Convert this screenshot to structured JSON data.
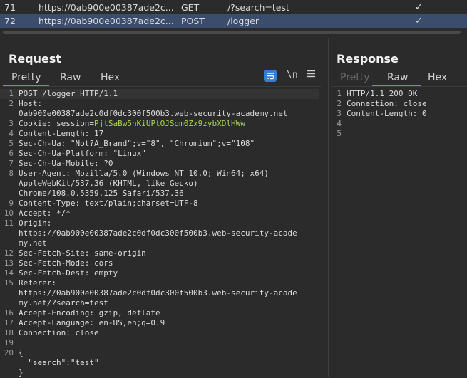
{
  "history": {
    "rows": [
      {
        "num": "71",
        "url": "https://0ab900e00387ade2c...",
        "method": "GET",
        "path": "/?search=test",
        "check": "✓"
      },
      {
        "num": "72",
        "url": "https://0ab900e00387ade2c...",
        "method": "POST",
        "path": "/logger",
        "check": "✓"
      }
    ]
  },
  "request": {
    "title": "Request",
    "tabs": [
      "Pretty",
      "Raw",
      "Hex"
    ],
    "icons": {
      "newline": "\\n",
      "menu": "☰"
    },
    "lines": [
      {
        "n": "1",
        "t": "POST /logger HTTP/1.1"
      },
      {
        "n": "2",
        "t": "Host:"
      },
      {
        "n": "",
        "t": "0ab900e00387ade2c0df0dc300f500b3.web-security-academy.net"
      },
      {
        "n": "3",
        "t": "Cookie: session="
      },
      {
        "n": "4",
        "t": "Content-Length: 17"
      },
      {
        "n": "5",
        "t": "Sec-Ch-Ua: \"Not?A_Brand\";v=\"8\", \"Chromium\";v=\"108\""
      },
      {
        "n": "6",
        "t": "Sec-Ch-Ua-Platform: \"Linux\""
      },
      {
        "n": "7",
        "t": "Sec-Ch-Ua-Mobile: ?0"
      },
      {
        "n": "8",
        "t": "User-Agent: Mozilla/5.0 (Windows NT 10.0; Win64; x64)"
      },
      {
        "n": "",
        "t": "AppleWebKit/537.36 (KHTML, like Gecko)"
      },
      {
        "n": "",
        "t": "Chrome/108.0.5359.125 Safari/537.36"
      },
      {
        "n": "9",
        "t": "Content-Type: text/plain;charset=UTF-8"
      },
      {
        "n": "10",
        "t": "Accept: */*"
      },
      {
        "n": "11",
        "t": "Origin:"
      },
      {
        "n": "",
        "t": "https://0ab900e00387ade2c0df0dc300f500b3.web-security-acade"
      },
      {
        "n": "",
        "t": "my.net"
      },
      {
        "n": "12",
        "t": "Sec-Fetch-Site: same-origin"
      },
      {
        "n": "13",
        "t": "Sec-Fetch-Mode: cors"
      },
      {
        "n": "14",
        "t": "Sec-Fetch-Dest: empty"
      },
      {
        "n": "15",
        "t": "Referer:"
      },
      {
        "n": "",
        "t": "https://0ab900e00387ade2c0df0dc300f500b3.web-security-acade"
      },
      {
        "n": "",
        "t": "my.net/?search=test"
      },
      {
        "n": "16",
        "t": "Accept-Encoding: gzip, deflate"
      },
      {
        "n": "17",
        "t": "Accept-Language: en-US,en;q=0.9"
      },
      {
        "n": "18",
        "t": "Connection: close"
      },
      {
        "n": "19",
        "t": ""
      },
      {
        "n": "20",
        "t": "{"
      },
      {
        "n": "",
        "t": "  \"search\":\"test\""
      },
      {
        "n": "",
        "t": "}"
      }
    ],
    "cookie_value": "PjtSaBw5nKiUPtOJSgm0Zx9zybXDlHWw"
  },
  "response": {
    "title": "Response",
    "tabs": [
      "Pretty",
      "Raw",
      "Hex"
    ],
    "lines": [
      {
        "n": "1",
        "t": "HTTP/1.1 200 OK"
      },
      {
        "n": "2",
        "t": "Connection: close"
      },
      {
        "n": "3",
        "t": "Content-Length: 0"
      },
      {
        "n": "4",
        "t": ""
      },
      {
        "n": "5",
        "t": ""
      }
    ]
  },
  "colors": {
    "accent": "#e06a2c",
    "selected_row": "#3b4d6d",
    "cookie": "#a6d25a",
    "wrap_button": "#3a7bd5"
  }
}
